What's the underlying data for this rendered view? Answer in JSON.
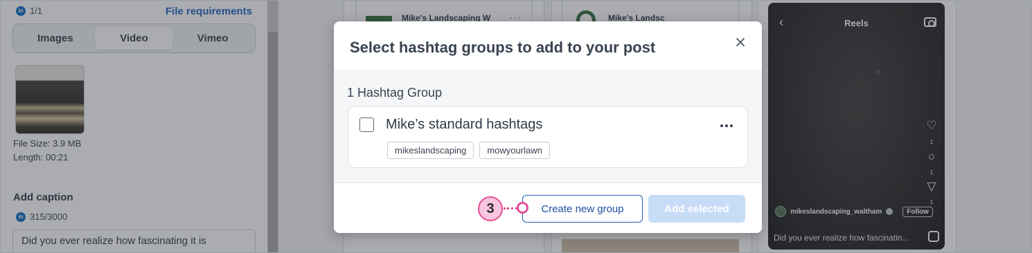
{
  "left_panel": {
    "account_count": "1/1",
    "linkedin_badge": "in",
    "file_requirements_link": "File requirements",
    "media_tabs": [
      "Images",
      "Video",
      "Vimeo"
    ],
    "active_media_tab": "Video",
    "file_size": "File Size: 3.9 MB",
    "length": "Length: 00:21",
    "add_caption_label": "Add caption",
    "caption_count": "315/3000",
    "caption_text": "Did you ever realize how fascinating it is"
  },
  "preview": {
    "post_card_1_name": "Mike's Landscaping W",
    "post_card_1_dots": "···",
    "post_card_2_name": "Mike's Landsc"
  },
  "reels": {
    "title": "Reels",
    "back_icon": "chevron-left-icon",
    "camera_icon": "camera-icon",
    "like_count": "1",
    "comment_count": "1",
    "share_count": "1",
    "username": "mikeslandscaping_waltham",
    "follow_label": "Follow",
    "caption_preview": "Did you ever realize how fascinatin..."
  },
  "modal": {
    "title": "Select hashtag groups to add to your post",
    "close_icon": "close-icon",
    "group_count_label": "1 Hashtag Group",
    "groups": [
      {
        "name": "Mike’s standard hashtags",
        "checked": false,
        "tags": [
          "mikeslandscaping",
          "mowyourlawn"
        ]
      }
    ],
    "create_button": "Create new group",
    "add_button": "Add selected",
    "add_button_enabled": false
  },
  "callout": {
    "step_number": "3",
    "color": "#e64f95"
  },
  "colors": {
    "primary_blue": "#1f5fbf",
    "disabled_blue": "#c7dcf6",
    "linkedin": "#0a66c2"
  }
}
